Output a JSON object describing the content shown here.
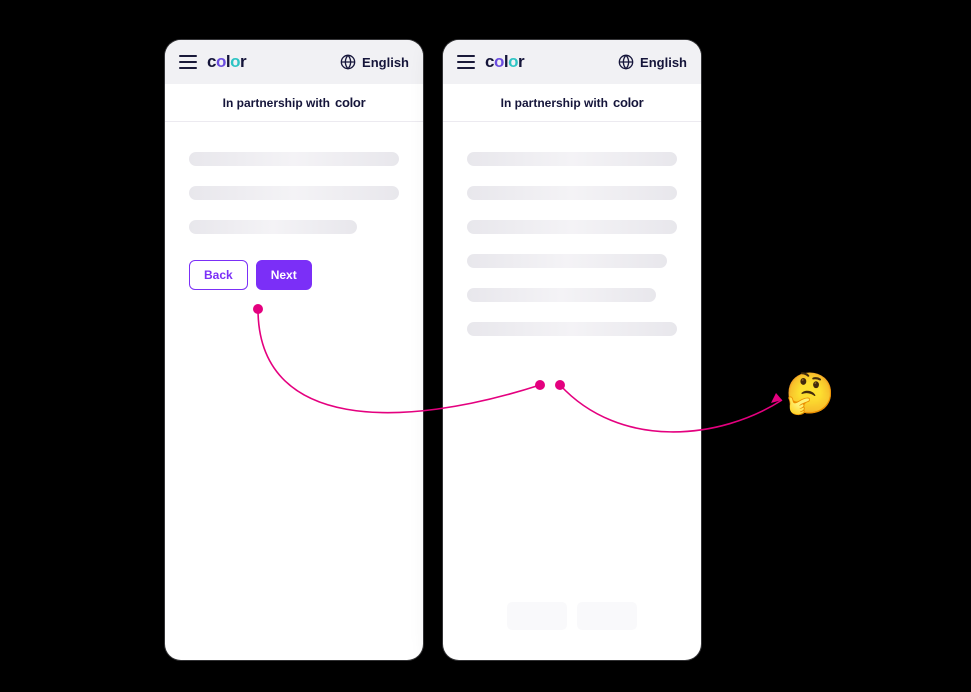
{
  "header": {
    "logo_text": "color",
    "language_label": "English",
    "menu_icon": "menu-icon",
    "globe_icon": "globe-icon"
  },
  "banner": {
    "partnership_text": "In partnership with",
    "partnership_logo": "color"
  },
  "phone1": {
    "buttons": {
      "back_label": "Back",
      "next_label": "Next"
    }
  },
  "annotations": {
    "emoji": "🤔",
    "connector_color": "#e4007f"
  }
}
